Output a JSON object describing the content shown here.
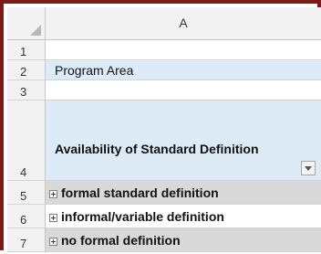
{
  "column_header": "A",
  "rows": [
    {
      "num": "1",
      "text": ""
    },
    {
      "num": "2",
      "text": "Program Area"
    },
    {
      "num": "3",
      "text": ""
    },
    {
      "num": "4",
      "text": "Availability of Standard Definition"
    },
    {
      "num": "5",
      "text": "formal standard definition"
    },
    {
      "num": "6",
      "text": "informal/variable definition"
    },
    {
      "num": "7",
      "text": "no formal definition"
    }
  ],
  "colors": {
    "frame_border": "#7b1a1a",
    "header_bg": "#f2f2f2",
    "pivot_blue": "#ddebf7",
    "pivot_grey": "#d9d9d9"
  },
  "icons": {
    "expand": "plus-box-icon",
    "filter": "dropdown-arrow-icon",
    "select_all": "select-all-triangle-icon"
  }
}
